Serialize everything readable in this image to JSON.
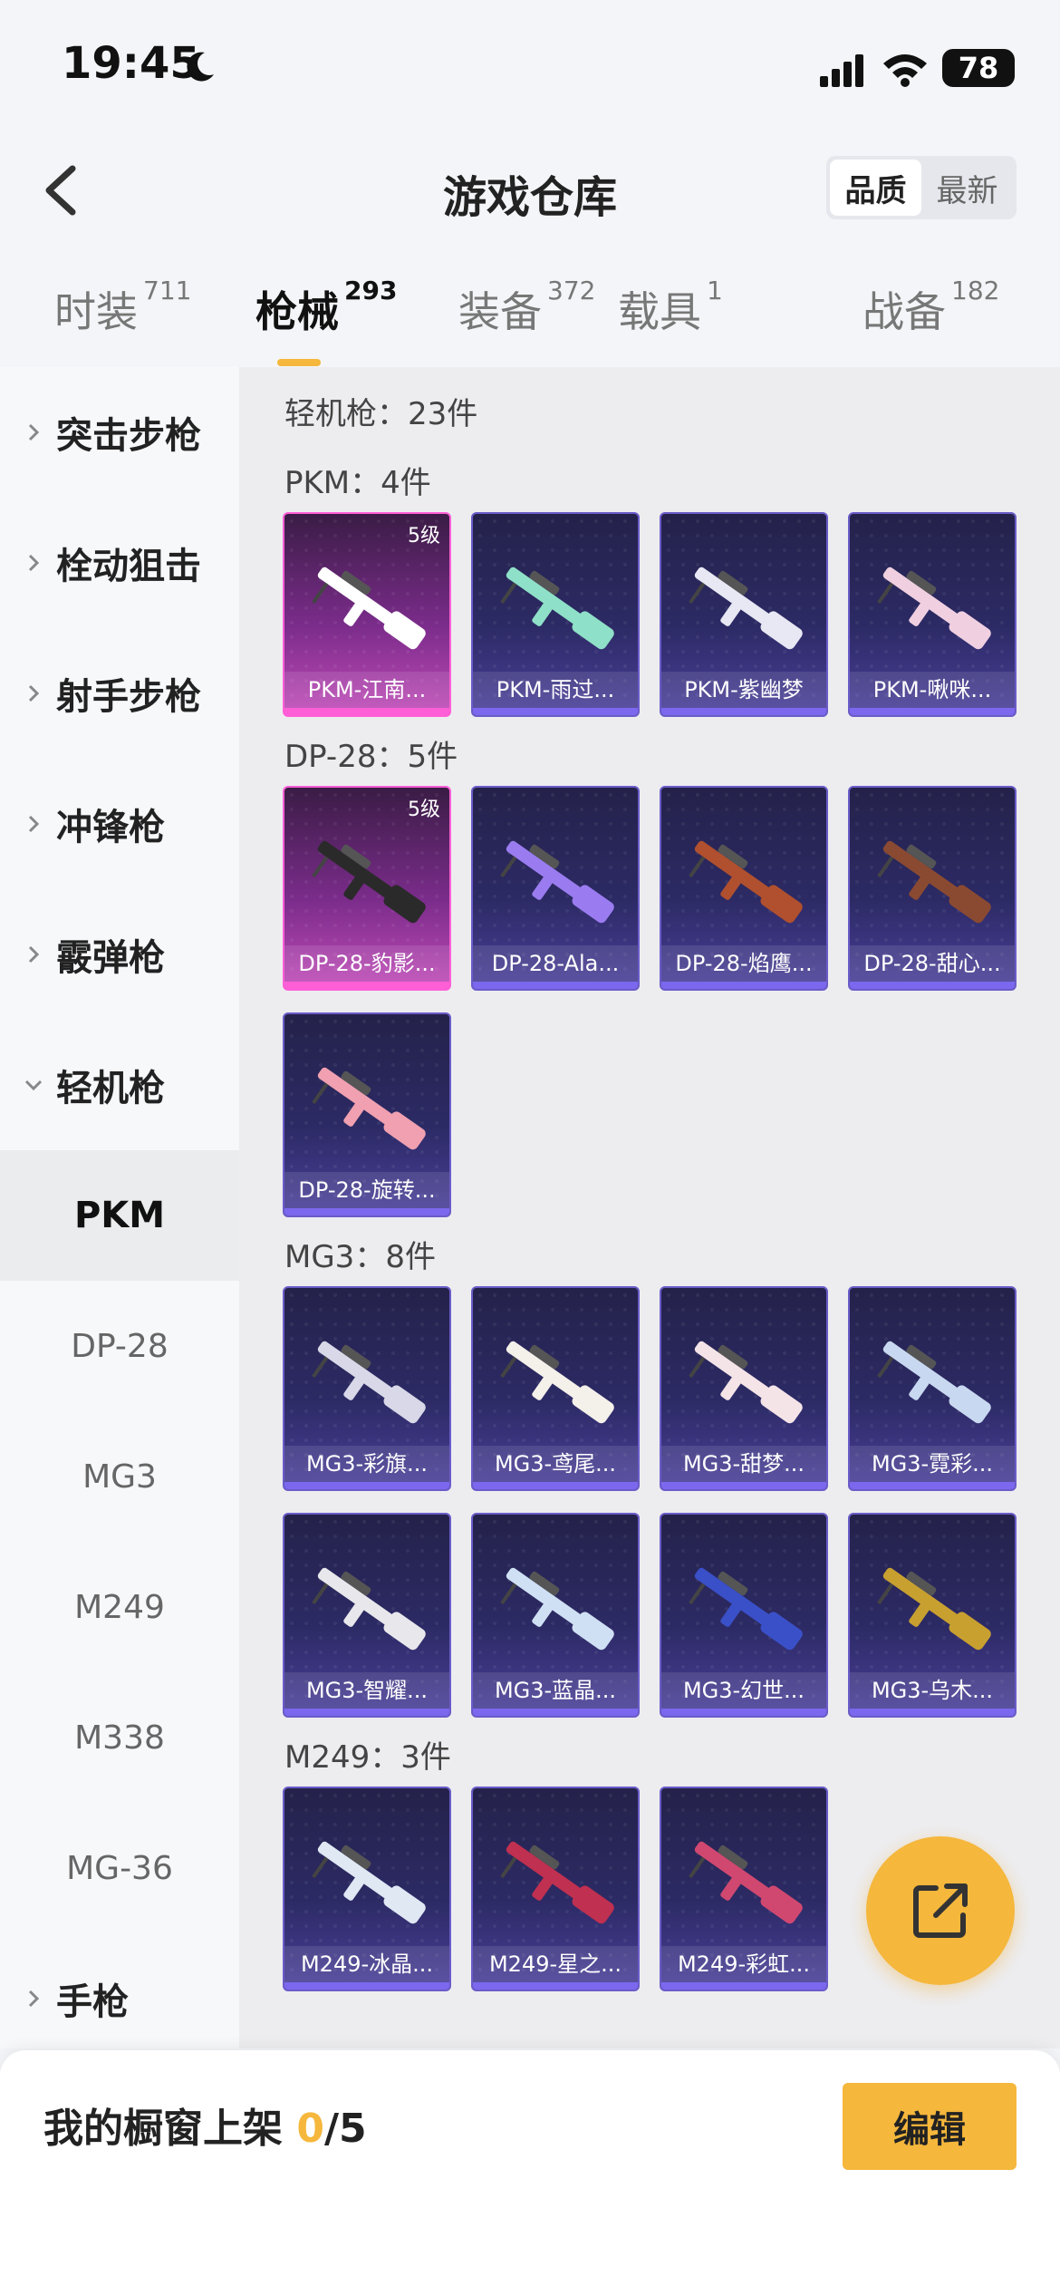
{
  "status": {
    "time": "19:45",
    "battery": "78"
  },
  "header": {
    "title": "游戏仓库",
    "seg_quality": "品质",
    "seg_latest": "最新"
  },
  "tabs": [
    {
      "label": "时装",
      "count": "711"
    },
    {
      "label": "枪械",
      "count": "293"
    },
    {
      "label": "装备",
      "count": "372"
    },
    {
      "label": "载具",
      "count": "1"
    },
    {
      "label": "战备",
      "count": "182"
    }
  ],
  "sidebar": {
    "cats": [
      "突击步枪",
      "栓动狙击",
      "射手步枪",
      "冲锋枪",
      "霰弹枪",
      "轻机枪"
    ],
    "subs": [
      "PKM",
      "DP-28",
      "MG3",
      "M249",
      "M338",
      "MG-36"
    ],
    "pistol": "手枪"
  },
  "content": {
    "total": "轻机枪：23件",
    "sections": [
      {
        "title": "PKM：4件",
        "items": [
          {
            "name": "PKM-江南...",
            "level": "5级",
            "rare": true,
            "color": "#ffffff"
          },
          {
            "name": "PKM-雨过...",
            "level": "",
            "rare": false,
            "color": "#8fe0c8"
          },
          {
            "name": "PKM-紫幽梦",
            "level": "",
            "rare": false,
            "color": "#e8e8f4"
          },
          {
            "name": "PKM-啾咪...",
            "level": "",
            "rare": false,
            "color": "#f0d0e0"
          }
        ]
      },
      {
        "title": "DP-28：5件",
        "items": [
          {
            "name": "DP-28-豹影...",
            "level": "5级",
            "rare": true,
            "color": "#2a2a2a"
          },
          {
            "name": "DP-28-Ala...",
            "level": "",
            "rare": false,
            "color": "#9a7cf0"
          },
          {
            "name": "DP-28-焰鹰...",
            "level": "",
            "rare": false,
            "color": "#b0502e"
          },
          {
            "name": "DP-28-甜心...",
            "level": "",
            "rare": false,
            "color": "#8a4a32"
          },
          {
            "name": "DP-28-旋转...",
            "level": "",
            "rare": false,
            "color": "#f0a0b0"
          }
        ]
      },
      {
        "title": "MG3：8件",
        "items": [
          {
            "name": "MG3-彩旗...",
            "level": "",
            "rare": false,
            "color": "#d8d8e8"
          },
          {
            "name": "MG3-鸢尾...",
            "level": "",
            "rare": false,
            "color": "#f4f0ea"
          },
          {
            "name": "MG3-甜梦...",
            "level": "",
            "rare": false,
            "color": "#f4e4e8"
          },
          {
            "name": "MG3-霓彩...",
            "level": "",
            "rare": false,
            "color": "#c8d8f0"
          },
          {
            "name": "MG3-智耀...",
            "level": "",
            "rare": false,
            "color": "#e8e8ec"
          },
          {
            "name": "MG3-蓝晶...",
            "level": "",
            "rare": false,
            "color": "#d0e0f4"
          },
          {
            "name": "MG3-幻世...",
            "level": "",
            "rare": false,
            "color": "#3a50c8"
          },
          {
            "name": "MG3-乌木...",
            "level": "",
            "rare": false,
            "color": "#c8a030"
          }
        ]
      },
      {
        "title": "M249：3件",
        "items": [
          {
            "name": "M249-冰晶...",
            "level": "",
            "rare": false,
            "color": "#e0e8f4"
          },
          {
            "name": "M249-星之...",
            "level": "",
            "rare": false,
            "color": "#c03050"
          },
          {
            "name": "M249-彩虹...",
            "level": "",
            "rare": false,
            "color": "#d04870"
          }
        ]
      }
    ]
  },
  "bottom": {
    "shelf_label": "我的橱窗上架 ",
    "shelf_count": "0",
    "shelf_total": "/5",
    "edit": "编辑"
  }
}
